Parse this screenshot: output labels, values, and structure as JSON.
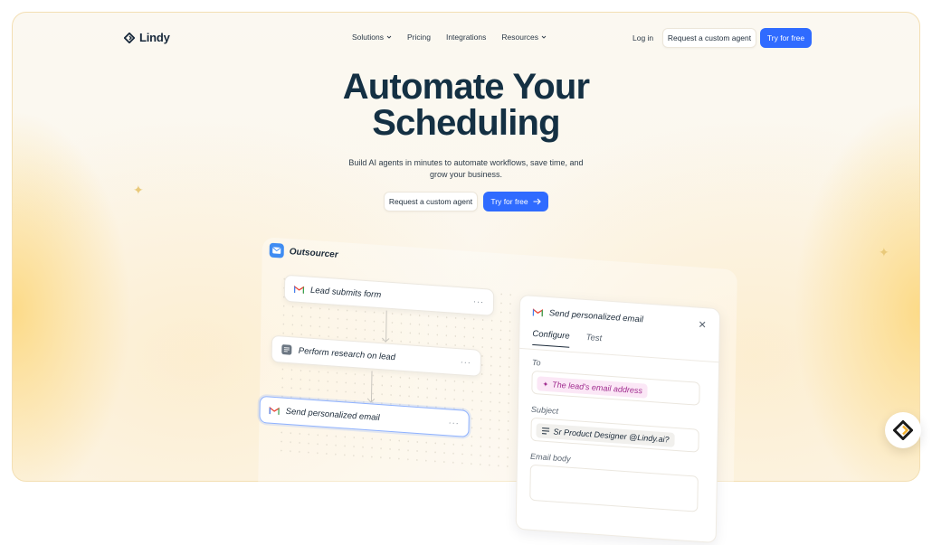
{
  "brand": {
    "name": "Lindy"
  },
  "nav": {
    "items": [
      {
        "label": "Solutions",
        "has_dropdown": true
      },
      {
        "label": "Pricing",
        "has_dropdown": false
      },
      {
        "label": "Integrations",
        "has_dropdown": false
      },
      {
        "label": "Resources",
        "has_dropdown": true
      }
    ],
    "login": "Log in",
    "request_agent": "Request a custom agent",
    "try_free": "Try for free"
  },
  "hero": {
    "title_line1": "Automate Your",
    "title_line2": "Scheduling",
    "subtitle_line1": "Build AI agents in minutes to automate workflows, save time, and",
    "subtitle_line2": "grow your business.",
    "cta_secondary": "Request a custom agent",
    "cta_primary": "Try for free"
  },
  "workflow": {
    "name": "Outsourcer",
    "nodes": [
      {
        "label": "Lead submits form",
        "icon": "gmail-icon"
      },
      {
        "label": "Perform research on lead",
        "icon": "research-icon"
      },
      {
        "label": "Send personalized email",
        "icon": "gmail-icon"
      }
    ],
    "node_menu": "···"
  },
  "panel": {
    "title": "Send personalized email",
    "tabs": [
      "Configure",
      "Test"
    ],
    "active_tab": "Configure",
    "to_label": "To",
    "to_value": "The lead's email address",
    "subject_label": "Subject",
    "subject_value": "Sr Product Designer @Lindy.ai?",
    "body_label": "Email body"
  },
  "colors": {
    "primary": "#2f6bff",
    "title": "#143043",
    "accent_pink": "#a12d8f",
    "glow": "#fcd678"
  }
}
